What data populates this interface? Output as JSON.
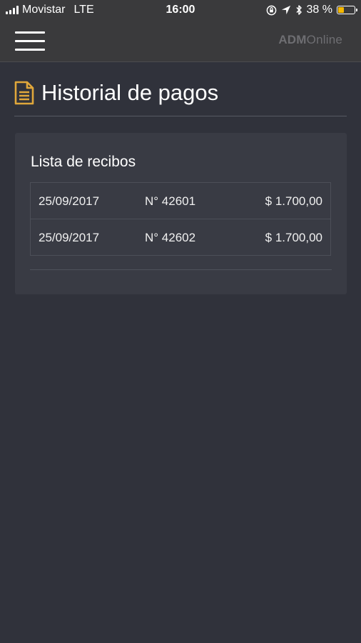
{
  "status_bar": {
    "carrier": "Movistar",
    "network": "LTE",
    "time": "16:00",
    "battery_percent": "38 %",
    "battery_level": 0.38,
    "icons": [
      "signal-bars-icon",
      "orientation-lock-icon",
      "location-arrow-icon",
      "bluetooth-icon",
      "battery-icon"
    ]
  },
  "header": {
    "menu_icon": "hamburger-menu-icon",
    "brand_bold": "ADM",
    "brand_light": "Online"
  },
  "page": {
    "title": "Historial de pagos",
    "title_icon": "document-icon"
  },
  "receipts_card": {
    "title": "Lista de recibos",
    "rows": [
      {
        "date": "25/09/2017",
        "number": "N° 42601",
        "amount": "$ 1.700,00"
      },
      {
        "date": "25/09/2017",
        "number": "N° 42602",
        "amount": "$ 1.700,00"
      }
    ]
  },
  "colors": {
    "background": "#30323b",
    "header": "#3a3a3c",
    "card": "#393b44",
    "accent": "#e0a73b",
    "brand_text": "#6e6e72"
  }
}
